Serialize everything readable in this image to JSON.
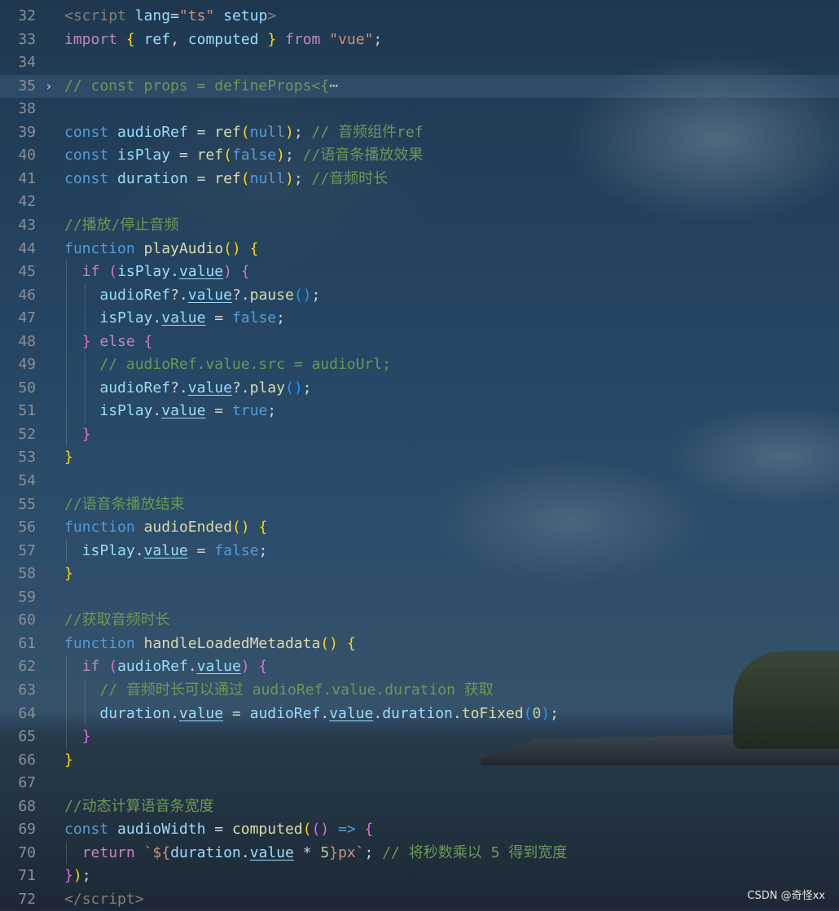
{
  "watermark": "CSDN @奇怪xx",
  "lines": [
    {
      "n": "32",
      "tokens": [
        [
          "<",
          "t-tag"
        ],
        [
          "script",
          "t-tag"
        ],
        [
          " ",
          ""
        ],
        [
          "lang",
          "t-attr"
        ],
        [
          "=",
          ""
        ],
        [
          "\"ts\"",
          "t-str"
        ],
        [
          " ",
          ""
        ],
        [
          "setup",
          "t-attr"
        ],
        [
          ">",
          "t-tag"
        ]
      ]
    },
    {
      "n": "33",
      "tokens": [
        [
          "import",
          "t-ctl"
        ],
        [
          " ",
          ""
        ],
        [
          "{",
          "t-p1"
        ],
        [
          " ",
          ""
        ],
        [
          "ref",
          "t-var"
        ],
        [
          ", ",
          ""
        ],
        [
          "computed",
          "t-var"
        ],
        [
          " ",
          ""
        ],
        [
          "}",
          "t-p1"
        ],
        [
          " ",
          ""
        ],
        [
          "from",
          "t-ctl"
        ],
        [
          " ",
          ""
        ],
        [
          "\"vue\"",
          "t-str"
        ],
        [
          ";",
          ""
        ]
      ]
    },
    {
      "n": "34",
      "tokens": []
    },
    {
      "n": "35",
      "fold": "›",
      "hl": true,
      "tokens": [
        [
          "// const props = defineProps<{",
          "t-com"
        ],
        [
          "⋯",
          "t-fold"
        ]
      ]
    },
    {
      "n": "38",
      "tokens": []
    },
    {
      "n": "39",
      "tokens": [
        [
          "const",
          "t-kw"
        ],
        [
          " ",
          ""
        ],
        [
          "audioRef",
          "t-var"
        ],
        [
          " = ",
          ""
        ],
        [
          "ref",
          "t-fn"
        ],
        [
          "(",
          "t-p1"
        ],
        [
          "null",
          "t-kw"
        ],
        [
          ")",
          "t-p1"
        ],
        [
          "; ",
          ""
        ],
        [
          "// 音频组件ref",
          "t-com"
        ]
      ]
    },
    {
      "n": "40",
      "tokens": [
        [
          "const",
          "t-kw"
        ],
        [
          " ",
          ""
        ],
        [
          "isPlay",
          "t-var"
        ],
        [
          " = ",
          ""
        ],
        [
          "ref",
          "t-fn"
        ],
        [
          "(",
          "t-p1"
        ],
        [
          "false",
          "t-kw"
        ],
        [
          ")",
          "t-p1"
        ],
        [
          "; ",
          ""
        ],
        [
          "//语音条播放效果",
          "t-com"
        ]
      ]
    },
    {
      "n": "41",
      "tokens": [
        [
          "const",
          "t-kw"
        ],
        [
          " ",
          ""
        ],
        [
          "duration",
          "t-var"
        ],
        [
          " = ",
          ""
        ],
        [
          "ref",
          "t-fn"
        ],
        [
          "(",
          "t-p1"
        ],
        [
          "null",
          "t-kw"
        ],
        [
          ")",
          "t-p1"
        ],
        [
          "; ",
          ""
        ],
        [
          "//音频时长",
          "t-com"
        ]
      ]
    },
    {
      "n": "42",
      "tokens": []
    },
    {
      "n": "43",
      "tokens": [
        [
          "//播放/停止音频",
          "t-com"
        ]
      ]
    },
    {
      "n": "44",
      "tokens": [
        [
          "function",
          "t-kw"
        ],
        [
          " ",
          ""
        ],
        [
          "playAudio",
          "t-fn"
        ],
        [
          "()",
          "t-p1"
        ],
        [
          " ",
          ""
        ],
        [
          "{",
          "t-p1"
        ]
      ]
    },
    {
      "n": "45",
      "tokens": [
        [
          "  ",
          ""
        ],
        [
          "if",
          "t-ctl"
        ],
        [
          " ",
          ""
        ],
        [
          "(",
          "t-p2"
        ],
        [
          "isPlay",
          "t-var"
        ],
        [
          ".",
          ""
        ],
        [
          "value",
          "t-var t-u"
        ],
        [
          ")",
          "t-p2"
        ],
        [
          " ",
          ""
        ],
        [
          "{",
          "t-p2"
        ]
      ]
    },
    {
      "n": "46",
      "tokens": [
        [
          "    ",
          ""
        ],
        [
          "audioRef",
          "t-var"
        ],
        [
          "?.",
          ""
        ],
        [
          "value",
          "t-var t-u"
        ],
        [
          "?.",
          ""
        ],
        [
          "pause",
          "t-fn"
        ],
        [
          "()",
          "t-p3"
        ],
        [
          ";",
          ""
        ]
      ]
    },
    {
      "n": "47",
      "tokens": [
        [
          "    ",
          ""
        ],
        [
          "isPlay",
          "t-var"
        ],
        [
          ".",
          ""
        ],
        [
          "value",
          "t-var t-u"
        ],
        [
          " = ",
          ""
        ],
        [
          "false",
          "t-kw"
        ],
        [
          ";",
          ""
        ]
      ]
    },
    {
      "n": "48",
      "tokens": [
        [
          "  ",
          ""
        ],
        [
          "}",
          "t-p2"
        ],
        [
          " ",
          ""
        ],
        [
          "else",
          "t-ctl"
        ],
        [
          " ",
          ""
        ],
        [
          "{",
          "t-p2"
        ]
      ]
    },
    {
      "n": "49",
      "tokens": [
        [
          "    ",
          ""
        ],
        [
          "// audioRef.value.src = audioUrl;",
          "t-com"
        ]
      ]
    },
    {
      "n": "50",
      "tokens": [
        [
          "    ",
          ""
        ],
        [
          "audioRef",
          "t-var"
        ],
        [
          "?.",
          ""
        ],
        [
          "value",
          "t-var t-u"
        ],
        [
          "?.",
          ""
        ],
        [
          "play",
          "t-fn"
        ],
        [
          "()",
          "t-p3"
        ],
        [
          ";",
          ""
        ]
      ]
    },
    {
      "n": "51",
      "tokens": [
        [
          "    ",
          ""
        ],
        [
          "isPlay",
          "t-var"
        ],
        [
          ".",
          ""
        ],
        [
          "value",
          "t-var t-u"
        ],
        [
          " = ",
          ""
        ],
        [
          "true",
          "t-kw"
        ],
        [
          ";",
          ""
        ]
      ]
    },
    {
      "n": "52",
      "tokens": [
        [
          "  ",
          ""
        ],
        [
          "}",
          "t-p2"
        ]
      ]
    },
    {
      "n": "53",
      "tokens": [
        [
          "}",
          "t-p1"
        ]
      ]
    },
    {
      "n": "54",
      "tokens": []
    },
    {
      "n": "55",
      "tokens": [
        [
          "//语音条播放结束",
          "t-com"
        ]
      ]
    },
    {
      "n": "56",
      "tokens": [
        [
          "function",
          "t-kw"
        ],
        [
          " ",
          ""
        ],
        [
          "audioEnded",
          "t-fn"
        ],
        [
          "()",
          "t-p1"
        ],
        [
          " ",
          ""
        ],
        [
          "{",
          "t-p1"
        ]
      ]
    },
    {
      "n": "57",
      "tokens": [
        [
          "  ",
          ""
        ],
        [
          "isPlay",
          "t-var"
        ],
        [
          ".",
          ""
        ],
        [
          "value",
          "t-var t-u"
        ],
        [
          " = ",
          ""
        ],
        [
          "false",
          "t-kw"
        ],
        [
          ";",
          ""
        ]
      ]
    },
    {
      "n": "58",
      "tokens": [
        [
          "}",
          "t-p1"
        ]
      ]
    },
    {
      "n": "59",
      "tokens": []
    },
    {
      "n": "60",
      "tokens": [
        [
          "//获取音频时长",
          "t-com"
        ]
      ]
    },
    {
      "n": "61",
      "tokens": [
        [
          "function",
          "t-kw"
        ],
        [
          " ",
          ""
        ],
        [
          "handleLoadedMetadata",
          "t-fn"
        ],
        [
          "()",
          "t-p1"
        ],
        [
          " ",
          ""
        ],
        [
          "{",
          "t-p1"
        ]
      ]
    },
    {
      "n": "62",
      "tokens": [
        [
          "  ",
          ""
        ],
        [
          "if",
          "t-ctl"
        ],
        [
          " ",
          ""
        ],
        [
          "(",
          "t-p2"
        ],
        [
          "audioRef",
          "t-var"
        ],
        [
          ".",
          ""
        ],
        [
          "value",
          "t-var t-u"
        ],
        [
          ")",
          "t-p2"
        ],
        [
          " ",
          ""
        ],
        [
          "{",
          "t-p2"
        ]
      ]
    },
    {
      "n": "63",
      "tokens": [
        [
          "    ",
          ""
        ],
        [
          "// 音频时长可以通过 audioRef.value.duration 获取",
          "t-com"
        ]
      ]
    },
    {
      "n": "64",
      "tokens": [
        [
          "    ",
          ""
        ],
        [
          "duration",
          "t-var"
        ],
        [
          ".",
          ""
        ],
        [
          "value",
          "t-var t-u"
        ],
        [
          " = ",
          ""
        ],
        [
          "audioRef",
          "t-var"
        ],
        [
          ".",
          ""
        ],
        [
          "value",
          "t-var t-u"
        ],
        [
          ".",
          ""
        ],
        [
          "duration",
          "t-var"
        ],
        [
          ".",
          ""
        ],
        [
          "toFixed",
          "t-fn"
        ],
        [
          "(",
          "t-p3"
        ],
        [
          "0",
          "t-num"
        ],
        [
          ")",
          "t-p3"
        ],
        [
          ";",
          ""
        ]
      ]
    },
    {
      "n": "65",
      "tokens": [
        [
          "  ",
          ""
        ],
        [
          "}",
          "t-p2"
        ]
      ]
    },
    {
      "n": "66",
      "tokens": [
        [
          "}",
          "t-p1"
        ]
      ]
    },
    {
      "n": "67",
      "tokens": []
    },
    {
      "n": "68",
      "tokens": [
        [
          "//动态计算语音条宽度",
          "t-com"
        ]
      ]
    },
    {
      "n": "69",
      "tokens": [
        [
          "const",
          "t-kw"
        ],
        [
          " ",
          ""
        ],
        [
          "audioWidth",
          "t-var"
        ],
        [
          " = ",
          ""
        ],
        [
          "computed",
          "t-fn"
        ],
        [
          "(",
          "t-p1"
        ],
        [
          "()",
          "t-p2"
        ],
        [
          " ",
          ""
        ],
        [
          "=>",
          "t-kw"
        ],
        [
          " ",
          ""
        ],
        [
          "{",
          "t-p2"
        ]
      ]
    },
    {
      "n": "70",
      "tokens": [
        [
          "  ",
          ""
        ],
        [
          "return",
          "t-ctl"
        ],
        [
          " ",
          ""
        ],
        [
          "`${",
          "t-str"
        ],
        [
          "duration",
          "t-var"
        ],
        [
          ".",
          ""
        ],
        [
          "value",
          "t-var t-u"
        ],
        [
          " * ",
          ""
        ],
        [
          "5",
          "t-num"
        ],
        [
          "}px`",
          "t-str"
        ],
        [
          "; ",
          ""
        ],
        [
          "// 将秒数乘以 5 得到宽度",
          "t-com"
        ]
      ]
    },
    {
      "n": "71",
      "tokens": [
        [
          "}",
          "t-p2"
        ],
        [
          ")",
          "t-p1"
        ],
        [
          ";",
          ""
        ]
      ]
    },
    {
      "n": "72",
      "tokens": [
        [
          "</",
          "t-tag"
        ],
        [
          "script",
          "t-tag"
        ],
        [
          ">",
          "t-tag"
        ]
      ]
    }
  ]
}
